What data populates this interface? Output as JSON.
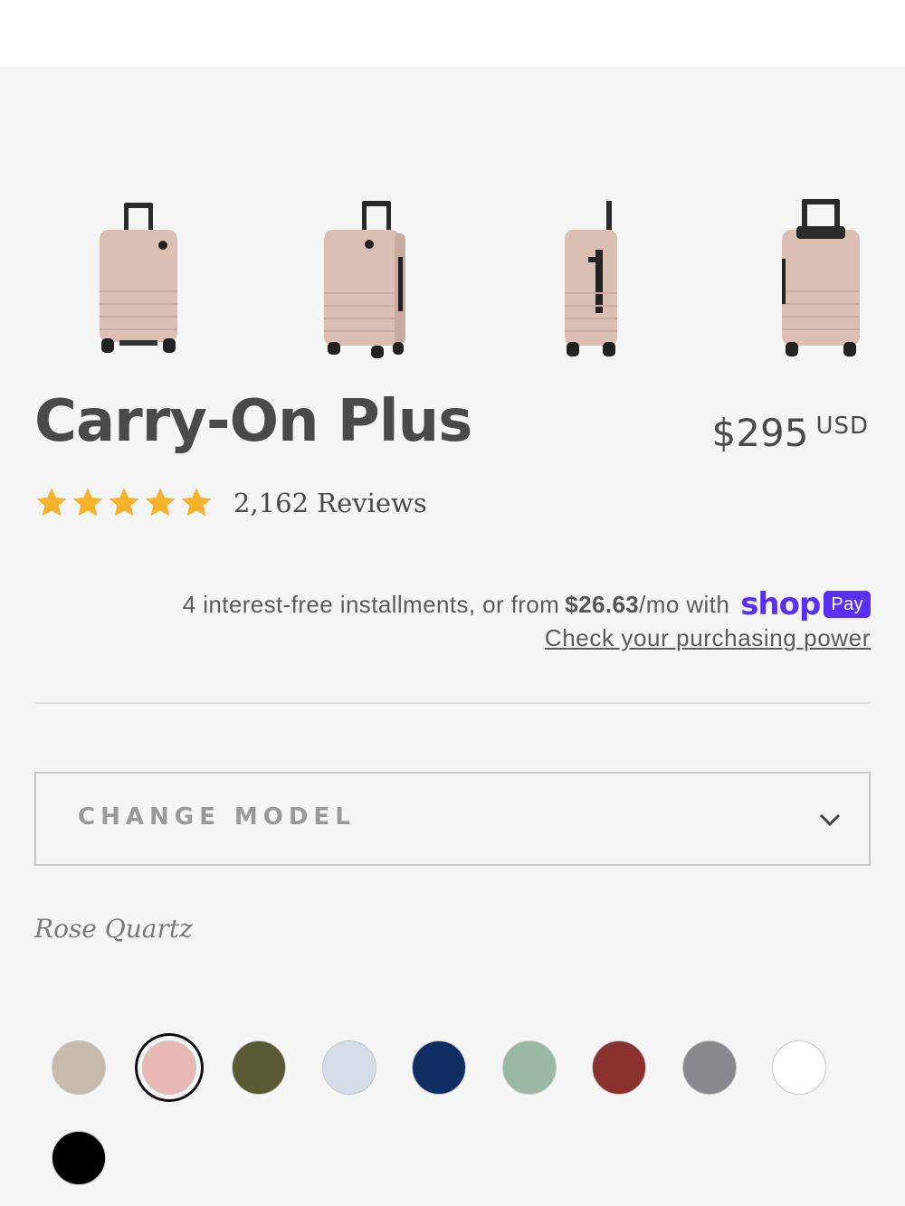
{
  "product": {
    "title": "Carry-On Plus",
    "price": "$295",
    "currency": "USD",
    "rating_stars": 5,
    "reviews_label": "2,162 Reviews"
  },
  "gallery": {
    "icons": [
      "luggage-front-icon",
      "luggage-angle-icon",
      "luggage-side-icon",
      "luggage-back-icon"
    ],
    "luggage_color": "#dcbfb3"
  },
  "installments": {
    "text_before": "4 interest-free installments, or from",
    "amount": "$26.63",
    "text_after": "/mo with",
    "brand_word": "shop",
    "brand_badge": "Pay",
    "brand_color": "#5a31f4",
    "link": "Check your purchasing power"
  },
  "model_select": {
    "label": "CHANGE MODEL"
  },
  "colors": {
    "selected_name": "Rose Quartz",
    "selected_index": 1,
    "swatches": [
      "#c8bbae",
      "#e8b8b3",
      "#5a5a34",
      "#d3dce7",
      "#0e2e63",
      "#99b8a5",
      "#8a3230",
      "#88898d",
      "#ffffff",
      "#000000"
    ]
  }
}
